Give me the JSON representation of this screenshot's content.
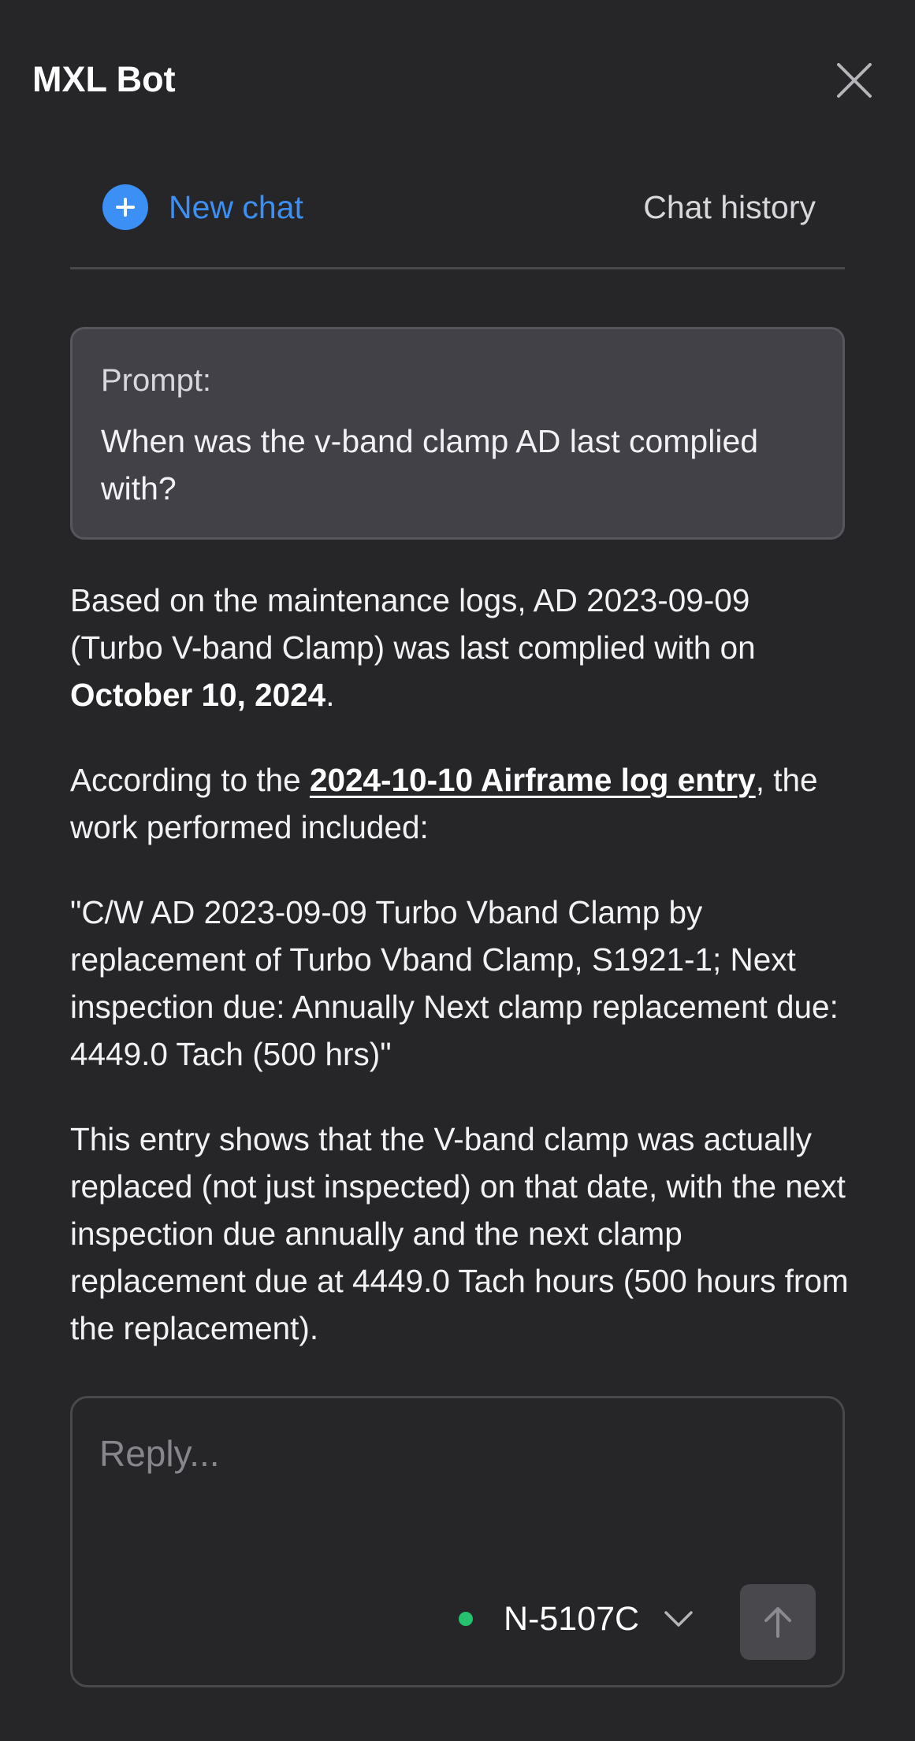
{
  "header": {
    "title": "MXL Bot",
    "close_icon": "close-icon"
  },
  "actions": {
    "new_chat_label": "New chat",
    "new_chat_icon": "plus-circle-icon",
    "chat_history_label": "Chat history"
  },
  "prompt": {
    "label": "Prompt:",
    "text": "When was the v-band clamp AD last complied with?"
  },
  "response": {
    "p1_text": "Based on the maintenance logs, AD 2023-09-09 (Turbo V-band Clamp) was last complied with on ",
    "p1_date": "October 10, 2024",
    "p1_end": ".",
    "p2_before": "According to the ",
    "p2_link": "2024-10-10 Airframe log entry",
    "p2_after": ", the work performed included:",
    "p3_quote": "\"C/W AD 2023-09-09 Turbo Vband Clamp by replacement of Turbo Vband Clamp, S1921-1; Next inspection due: Annually Next clamp replacement due: 4449.0 Tach (500 hrs)\"",
    "p4_text": "This entry shows that the V-band clamp was actually replaced (not just inspected) on that date, with the next inspection due annually and the next clamp replacement due at 4449.0 Tach hours (500 hours from the replacement)."
  },
  "reply": {
    "placeholder": "Reply...",
    "value": "",
    "aircraft": "N-5107C",
    "aircraft_status_color": "#25c16f",
    "dropdown_icon": "chevron-down-icon",
    "send_icon": "arrow-up-icon"
  },
  "colors": {
    "background": "#262629",
    "accent": "#3b8ff5",
    "card": "#414147",
    "status_online": "#25c16f"
  }
}
